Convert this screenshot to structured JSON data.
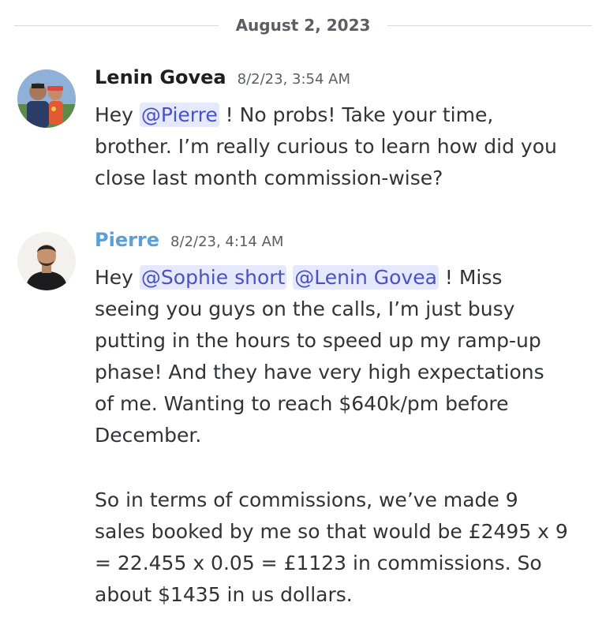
{
  "date_divider": "August 2, 2023",
  "messages": [
    {
      "author": "Lenin Govea",
      "timestamp": "8/2/23, 3:54 AM",
      "lines": [
        {
          "pre": "Hey ",
          "mention": "@Pierre",
          "post": " ! No probs! Take your time,"
        },
        "brother. I’m really curious to learn how did you",
        "close last month commission-wise?"
      ]
    },
    {
      "author": "Pierre",
      "timestamp": "8/2/23, 4:14 AM",
      "lines": [
        {
          "pre": "Hey ",
          "mention1": "@Sophie short",
          "mention2": "@Lenin Govea",
          "post": "  ! Miss"
        },
        "seeing you guys on the calls, I’m just busy",
        "putting in the hours to speed up my ramp-up",
        "phase! And they have very high expectations",
        "of me. Wanting to reach $640k/pm before",
        "December."
      ],
      "lines2": [
        "So in terms of commissions, we’ve made 9",
        "sales booked by me so that would be £2495 x 9",
        "= 22.455 x 0.05 =  £1123 in commissions. So",
        "about $1435 in us dollars."
      ]
    }
  ],
  "colors": {
    "mention_bg": "#e6e8fd",
    "mention_text": "#4752c4",
    "author2_color": "#5a9fd6"
  }
}
